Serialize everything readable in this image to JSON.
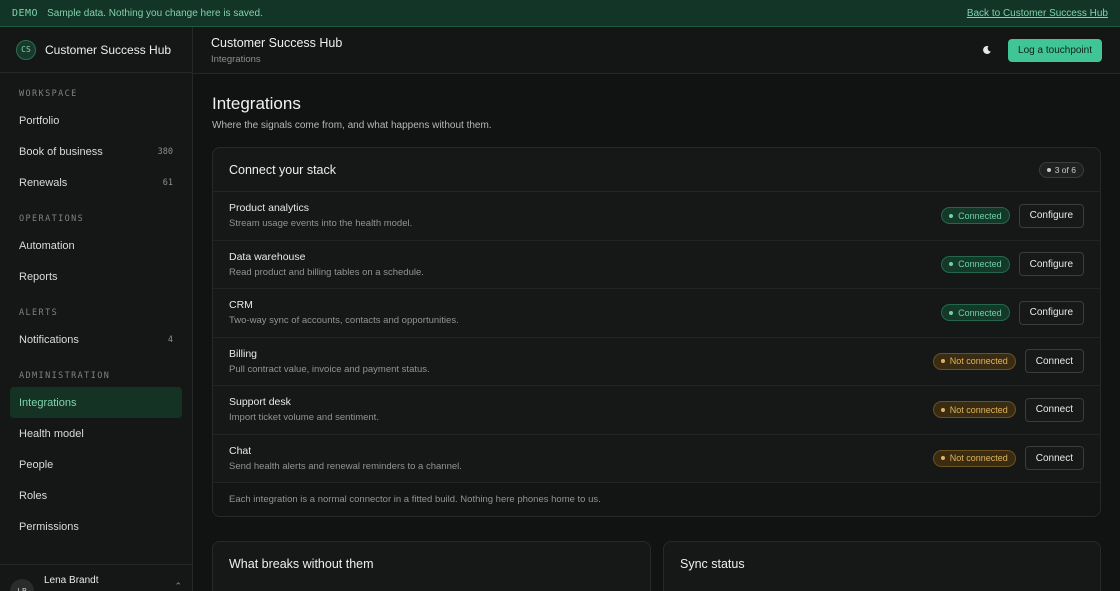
{
  "banner": {
    "tag": "DEMO",
    "message": "Sample data. Nothing you change here is saved.",
    "back_link": "Back to Customer Success Hub"
  },
  "brand": {
    "initials": "CS",
    "name": "Customer Success Hub"
  },
  "sidebar": {
    "sections": [
      {
        "label": "WORKSPACE",
        "items": [
          {
            "label": "Portfolio",
            "count": ""
          },
          {
            "label": "Book of business",
            "count": "380"
          },
          {
            "label": "Renewals",
            "count": "61"
          }
        ]
      },
      {
        "label": "OPERATIONS",
        "items": [
          {
            "label": "Automation",
            "count": ""
          },
          {
            "label": "Reports",
            "count": ""
          }
        ]
      },
      {
        "label": "ALERTS",
        "items": [
          {
            "label": "Notifications",
            "count": "4"
          }
        ]
      },
      {
        "label": "ADMINISTRATION",
        "items": [
          {
            "label": "Integrations",
            "count": "",
            "active": true
          },
          {
            "label": "Health model",
            "count": ""
          },
          {
            "label": "People",
            "count": ""
          },
          {
            "label": "Roles",
            "count": ""
          },
          {
            "label": "Permissions",
            "count": ""
          }
        ]
      }
    ],
    "user": {
      "initials": "LB",
      "name": "Lena Brandt"
    }
  },
  "header": {
    "title": "Customer Success Hub",
    "breadcrumb": "Integrations",
    "theme_icon": "moon-icon",
    "primary_action": "Log a touchpoint"
  },
  "main": {
    "title": "Integrations",
    "subtitle": "Where the signals come from, and what happens without them.",
    "stack_card": {
      "title": "Connect your stack",
      "count_badge": "3 of 6",
      "rows": [
        {
          "name": "Product analytics",
          "desc": "Stream usage events into the health model.",
          "status": "Connected",
          "connected": true,
          "action": "Configure"
        },
        {
          "name": "Data warehouse",
          "desc": "Read product and billing tables on a schedule.",
          "status": "Connected",
          "connected": true,
          "action": "Configure"
        },
        {
          "name": "CRM",
          "desc": "Two-way sync of accounts, contacts and opportunities.",
          "status": "Connected",
          "connected": true,
          "action": "Configure"
        },
        {
          "name": "Billing",
          "desc": "Pull contract value, invoice and payment status.",
          "status": "Not connected",
          "connected": false,
          "action": "Connect"
        },
        {
          "name": "Support desk",
          "desc": "Import ticket volume and sentiment.",
          "status": "Not connected",
          "connected": false,
          "action": "Connect"
        },
        {
          "name": "Chat",
          "desc": "Send health alerts and renewal reminders to a channel.",
          "status": "Not connected",
          "connected": false,
          "action": "Connect"
        }
      ],
      "footer": "Each integration is a normal connector in a fitted build. Nothing here phones home to us."
    },
    "breaks_card": {
      "title": "What breaks without them"
    },
    "sync_card": {
      "title": "Sync status"
    }
  },
  "colors": {
    "accent": "#3fc596",
    "connected": "#6fd1a5",
    "not_connected": "#e0b45a",
    "banner_bg": "#123528"
  }
}
